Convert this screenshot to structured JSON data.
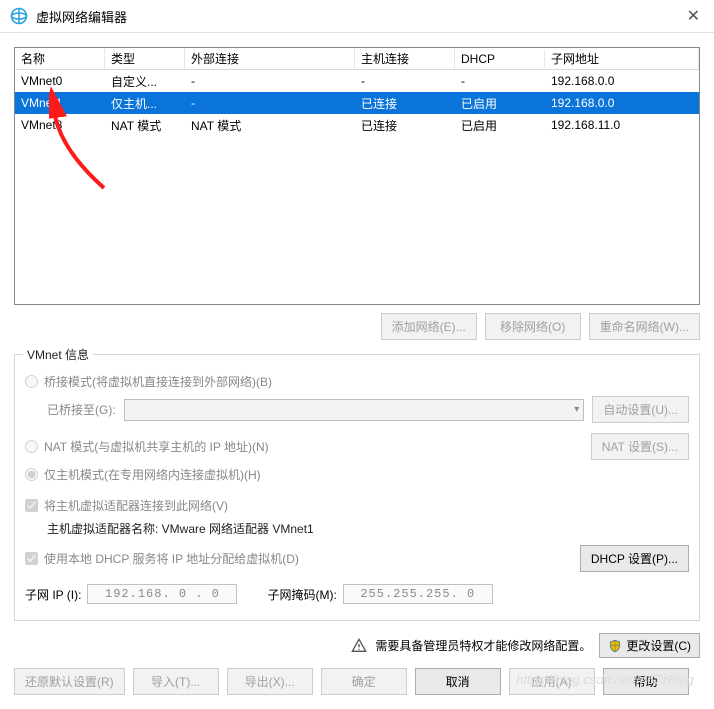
{
  "window": {
    "title": "虚拟网络编辑器"
  },
  "table": {
    "headers": {
      "name": "名称",
      "type": "类型",
      "ext": "外部连接",
      "host": "主机连接",
      "dhcp": "DHCP",
      "subnet": "子网地址"
    },
    "rows": [
      {
        "name": "VMnet0",
        "type": "自定义...",
        "ext": "-",
        "host": "-",
        "dhcp": "-",
        "subnet": "192.168.0.0",
        "selected": false
      },
      {
        "name": "VMnet1",
        "type": "仅主机...",
        "ext": "-",
        "host": "已连接",
        "dhcp": "已启用",
        "subnet": "192.168.0.0",
        "selected": true
      },
      {
        "name": "VMnet8",
        "type": "NAT 模式",
        "ext": "NAT 模式",
        "host": "已连接",
        "dhcp": "已启用",
        "subnet": "192.168.11.0",
        "selected": false
      }
    ]
  },
  "buttons": {
    "addNetwork": "添加网络(E)...",
    "removeNetwork": "移除网络(O)",
    "renameNetwork": "重命名网络(W)...",
    "autoSettings": "自动设置(U)...",
    "natSettings": "NAT 设置(S)...",
    "dhcpSettings": "DHCP 设置(P)...",
    "changeSettings": "更改设置(C)",
    "restoreDefaults": "还原默认设置(R)",
    "import": "导入(T)...",
    "export": "导出(X)...",
    "ok": "确定",
    "cancel": "取消",
    "apply": "应用(A)",
    "help": "帮助"
  },
  "info": {
    "legend": "VMnet 信息",
    "bridged": "桥接模式(将虚拟机直接连接到外部网络)(B)",
    "bridgedTo": "已桥接至(G):",
    "nat": "NAT 模式(与虚拟机共享主机的 IP 地址)(N)",
    "hostOnly": "仅主机模式(在专用网络内连接虚拟机)(H)",
    "connectHost": "将主机虚拟适配器连接到此网络(V)",
    "adapterName": "主机虚拟适配器名称: VMware 网络适配器 VMnet1",
    "useDhcp": "使用本地 DHCP 服务将 IP 地址分配给虚拟机(D)",
    "subnetIp": "子网 IP (I):",
    "subnetIpVal": "192.168. 0 . 0",
    "subnetMask": "子网掩码(M):",
    "subnetMaskVal": "255.255.255. 0"
  },
  "warning": "需要具备管理员特权才能修改网络配置。",
  "watermark": "https://blog.csdn.net/m67zBlog"
}
